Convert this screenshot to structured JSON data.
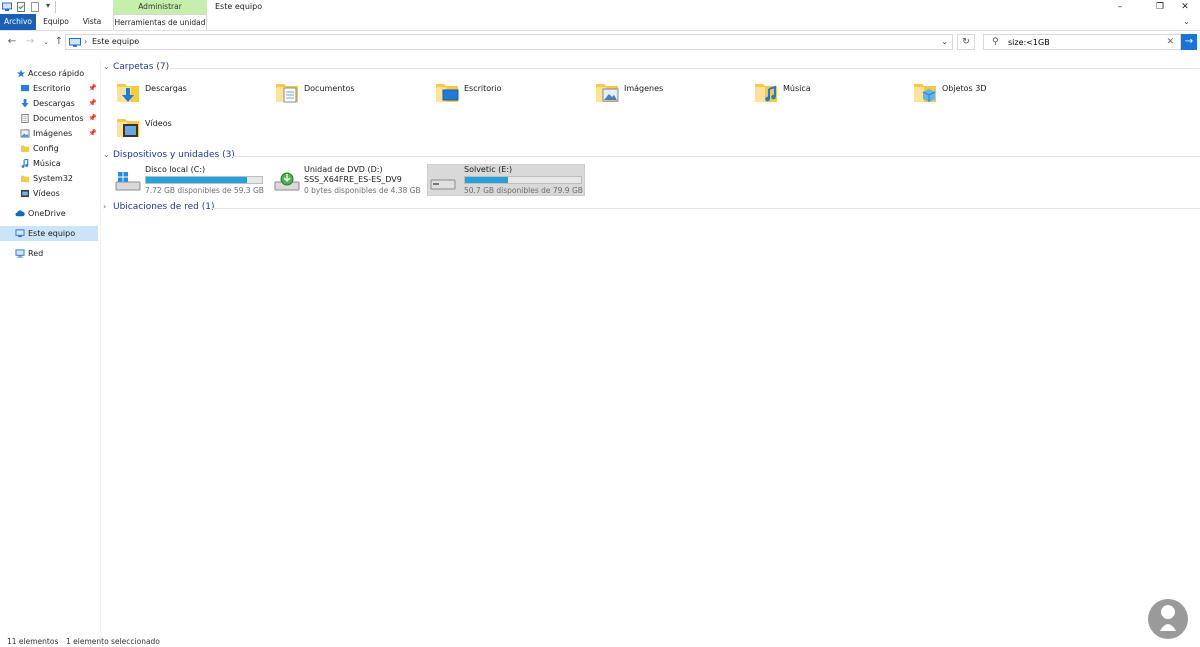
{
  "window": {
    "context_tab_header": "Administrar",
    "title": "Este equipo"
  },
  "ribbon": {
    "tabs": [
      "Archivo",
      "Equipo",
      "Vista",
      "Herramientas de unidad"
    ]
  },
  "address": {
    "breadcrumb": "Este equipo"
  },
  "search": {
    "query": "size:<1GB"
  },
  "sidebar": {
    "items": [
      {
        "label": "Acceso rápido",
        "icon": "star-icon"
      },
      {
        "label": "Escritorio",
        "icon": "desktop-icon",
        "pinned": true
      },
      {
        "label": "Descargas",
        "icon": "download-arrow-icon",
        "pinned": true
      },
      {
        "label": "Documentos",
        "icon": "document-icon",
        "pinned": true
      },
      {
        "label": "Imágenes",
        "icon": "picture-icon",
        "pinned": true
      },
      {
        "label": "Config",
        "icon": "folder-icon"
      },
      {
        "label": "Música",
        "icon": "music-note-icon"
      },
      {
        "label": "System32",
        "icon": "folder-icon"
      },
      {
        "label": "Vídeos",
        "icon": "video-icon"
      },
      {
        "label": "OneDrive",
        "icon": "cloud-icon"
      },
      {
        "label": "Este equipo",
        "icon": "computer-icon",
        "selected": true
      },
      {
        "label": "Red",
        "icon": "network-icon"
      }
    ]
  },
  "main": {
    "folders_header": "Carpetas (7)",
    "folders": [
      {
        "label": "Descargas",
        "icon": "download-arrow-icon"
      },
      {
        "label": "Documentos",
        "icon": "document-icon"
      },
      {
        "label": "Escritorio",
        "icon": "desktop-icon"
      },
      {
        "label": "Imágenes",
        "icon": "picture-icon"
      },
      {
        "label": "Música",
        "icon": "music-note-icon"
      },
      {
        "label": "Objetos 3D",
        "icon": "cube-icon"
      },
      {
        "label": "Vídeos",
        "icon": "video-icon"
      }
    ],
    "devices_header": "Dispositivos y unidades (3)",
    "drives": [
      {
        "name": "Disco local (C:)",
        "space": "7.72 GB disponibles de 59.3 GB",
        "used_fraction": 0.87
      },
      {
        "name": "Unidad de DVD (D:)",
        "name2": "SSS_X64FRE_ES-ES_DV9",
        "space": "0 bytes disponibles de 4.38 GB"
      },
      {
        "name": "Solvetic (E:)",
        "space": "50.7 GB disponibles de 79.9 GB",
        "used_fraction": 0.37,
        "selected": true
      }
    ],
    "network_header": "Ubicaciones de red (1)"
  },
  "status": {
    "count": "11 elementos",
    "selection": "1 elemento seleccionado"
  },
  "colors": {
    "accent": "#1a73d9",
    "file_tab": "#1a5fb4",
    "context_tab": "#c6efad",
    "selection": "#cce4f7",
    "drive_bar": "#26a0da",
    "folder_yellow": "#f5c84c"
  }
}
